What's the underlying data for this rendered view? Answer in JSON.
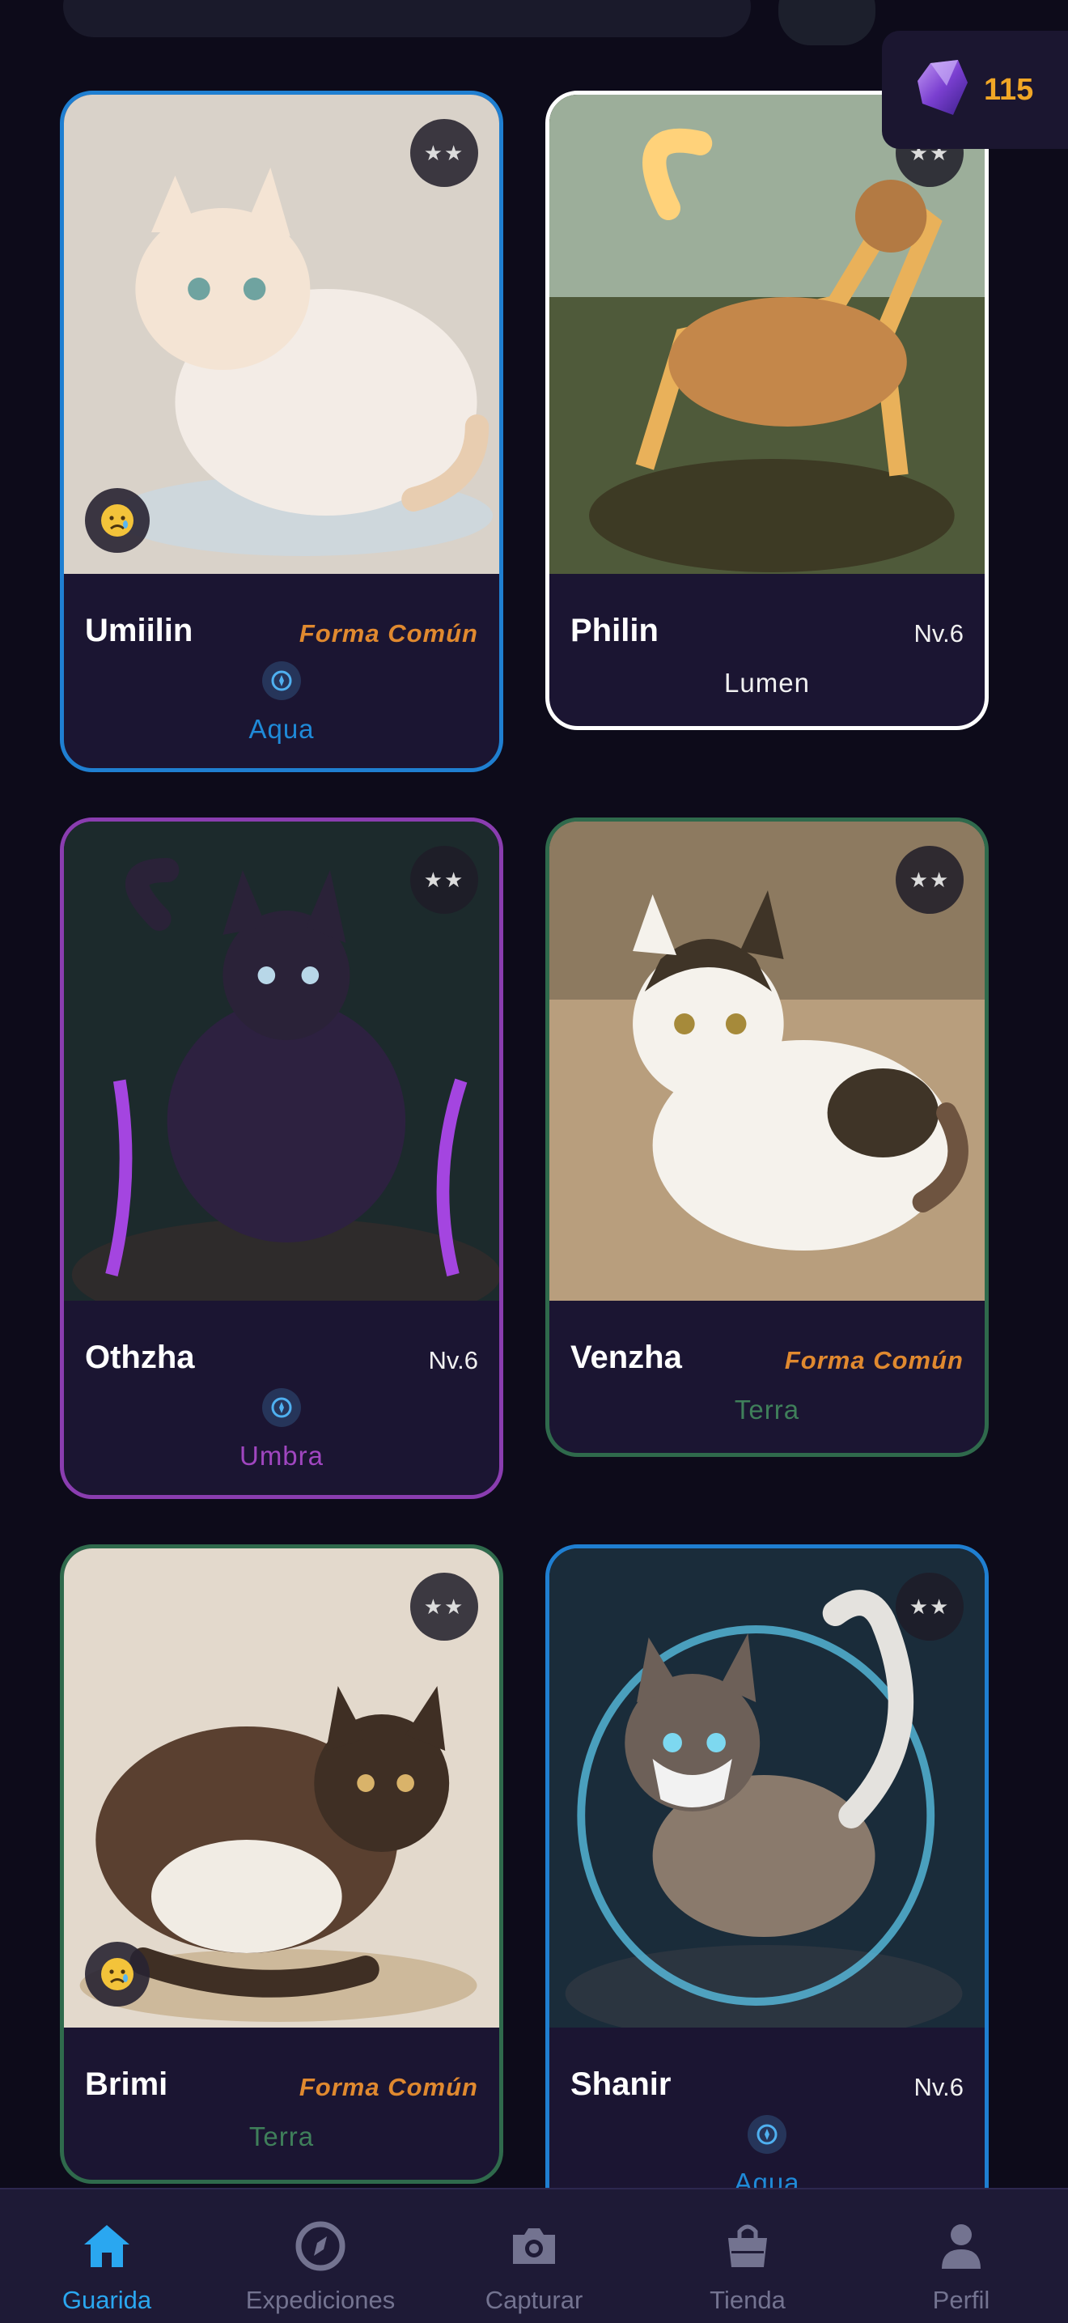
{
  "currency": {
    "crystals": "115"
  },
  "cards": [
    {
      "name": "Umiilin",
      "meta": "Forma Común",
      "meta_type": "form",
      "element": "Aqua",
      "element_icon": "compass-icon",
      "stars": "★★",
      "mood": "sad",
      "border": "#1f7fd1",
      "element_color": "#1f8ad8"
    },
    {
      "name": "Philin",
      "meta": "Nv.6",
      "meta_type": "level",
      "element": "Lumen",
      "element_icon": "",
      "stars": "★★",
      "mood": "",
      "border": "#ffffff",
      "element_color": "#f0f0f0"
    },
    {
      "name": "Othzha",
      "meta": "Nv.6",
      "meta_type": "level",
      "element": "Umbra",
      "element_icon": "compass-icon",
      "stars": "★★",
      "mood": "",
      "border": "#8a3db0",
      "element_color": "#a046c0"
    },
    {
      "name": "Venzha",
      "meta": "Forma Común",
      "meta_type": "form",
      "element": "Terra",
      "element_icon": "",
      "stars": "★★",
      "mood": "",
      "border": "#2f6a4c",
      "element_color": "#3f7f5a"
    },
    {
      "name": "Brimi",
      "meta": "Forma Común",
      "meta_type": "form",
      "element": "Terra",
      "element_icon": "",
      "stars": "★★",
      "mood": "sad",
      "border": "#2f6a4c",
      "element_color": "#3f7f5a"
    },
    {
      "name": "Shanir",
      "meta": "Nv.6",
      "meta_type": "level",
      "element": "Aqua",
      "element_icon": "compass-icon",
      "stars": "★★",
      "mood": "",
      "border": "#1f7fd1",
      "element_color": "#1f8ad8"
    }
  ],
  "nav": [
    {
      "label": "Guarida",
      "icon": "home-icon",
      "active": true
    },
    {
      "label": "Expediciones",
      "icon": "compass-icon",
      "active": false
    },
    {
      "label": "Capturar",
      "icon": "camera-icon",
      "active": false
    },
    {
      "label": "Tienda",
      "icon": "shopping-bag-icon",
      "active": false
    },
    {
      "label": "Perfil",
      "icon": "user-icon",
      "active": false
    }
  ]
}
